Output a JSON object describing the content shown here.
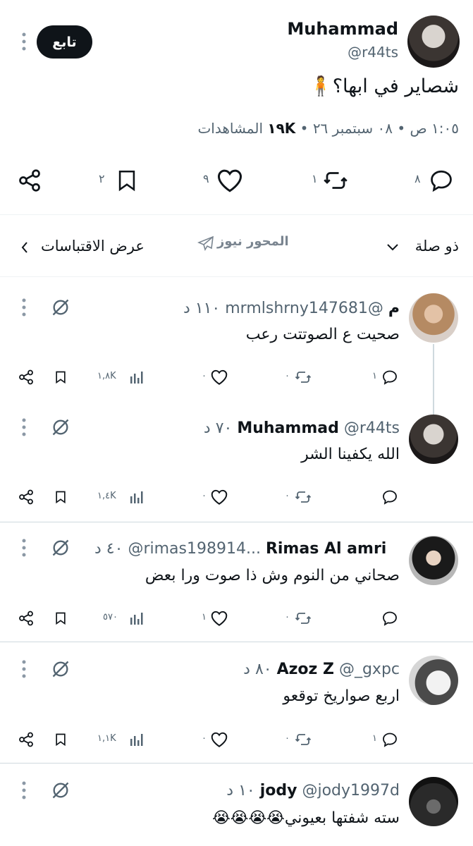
{
  "main": {
    "name": "Muhammad",
    "handle": "@r44ts",
    "follow_label": "تابع",
    "text": "شصاير في ابها؟",
    "text_emoji": "🧍",
    "meta_time": "١:٠٥ ص • ٠٨ سبتمبر ٢٦ •",
    "meta_views_count": "١٩K",
    "meta_views_label": "المشاهدات",
    "replies": "٨",
    "retweets": "١",
    "likes": "٩",
    "bookmarks": "٢"
  },
  "filter_bar": {
    "relevance_label": "ذو صلة",
    "quotes_label": "عرض الاقتباسات",
    "watermark": "المحور نيوز"
  },
  "replies": [
    {
      "name": "م",
      "handle": "@mrmlshrny147681",
      "time": "١١٠ د",
      "text": "صحيت ع الصوتتت رعب",
      "replies": "١",
      "retweets": "٠",
      "likes": "٠",
      "views": "١,٨K"
    },
    {
      "name": "Muhammad",
      "handle": "@r44ts",
      "time": "٧٠ د",
      "text": "الله يكفينا الشر",
      "replies": "",
      "retweets": "٠",
      "likes": "٠",
      "views": "١,٤K"
    },
    {
      "name": "Rimas Al amri",
      "handle": "@rimas198914...",
      "time": "٤٠ د",
      "text": "صحاني من النوم وش ذا صوت ورا بعض",
      "replies": "",
      "retweets": "٠",
      "likes": "١",
      "views": "٥٧٠"
    },
    {
      "name": "Azoz Z",
      "handle": "@_gxpc",
      "time": "٨٠ د",
      "text": "اربع صواريخ توقعو",
      "replies": "١",
      "retweets": "٠",
      "likes": "٠",
      "views": "١,١K"
    },
    {
      "name": "jody",
      "handle": "@jody1997d",
      "time": "١٠ د",
      "text": "سته شفتها بعيوني",
      "text_emoji": "😭😭😭😭"
    }
  ],
  "colors": {
    "text": "#0f1419",
    "secondary": "#536471",
    "divider": "#eff3f4",
    "button_bg": "#0f1419"
  }
}
